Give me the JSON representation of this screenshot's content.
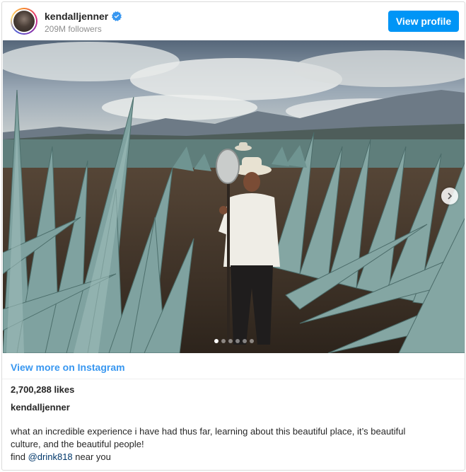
{
  "header": {
    "username": "kendalljenner",
    "followers": "209M followers",
    "view_profile_label": "View profile"
  },
  "media": {
    "carousel_count": 6,
    "active_index": 0
  },
  "footer": {
    "view_more_label": "View more on Instagram",
    "likes": "2,700,288 likes",
    "caption_username": "kendalljenner",
    "caption_line1": "what an incredible experience i have had thus far, learning about this beautiful place, it’s beautiful",
    "caption_line2": "culture, and the beautiful people!",
    "caption_find": "find",
    "caption_mention": "@drink818",
    "caption_near": "near you"
  },
  "icons": {
    "verified": "verified-badge-icon",
    "next": "chevron-right-icon"
  },
  "colors": {
    "accent": "#0095f6",
    "link": "#3897f0",
    "mention": "#00376b",
    "verified": "#3897f0"
  }
}
